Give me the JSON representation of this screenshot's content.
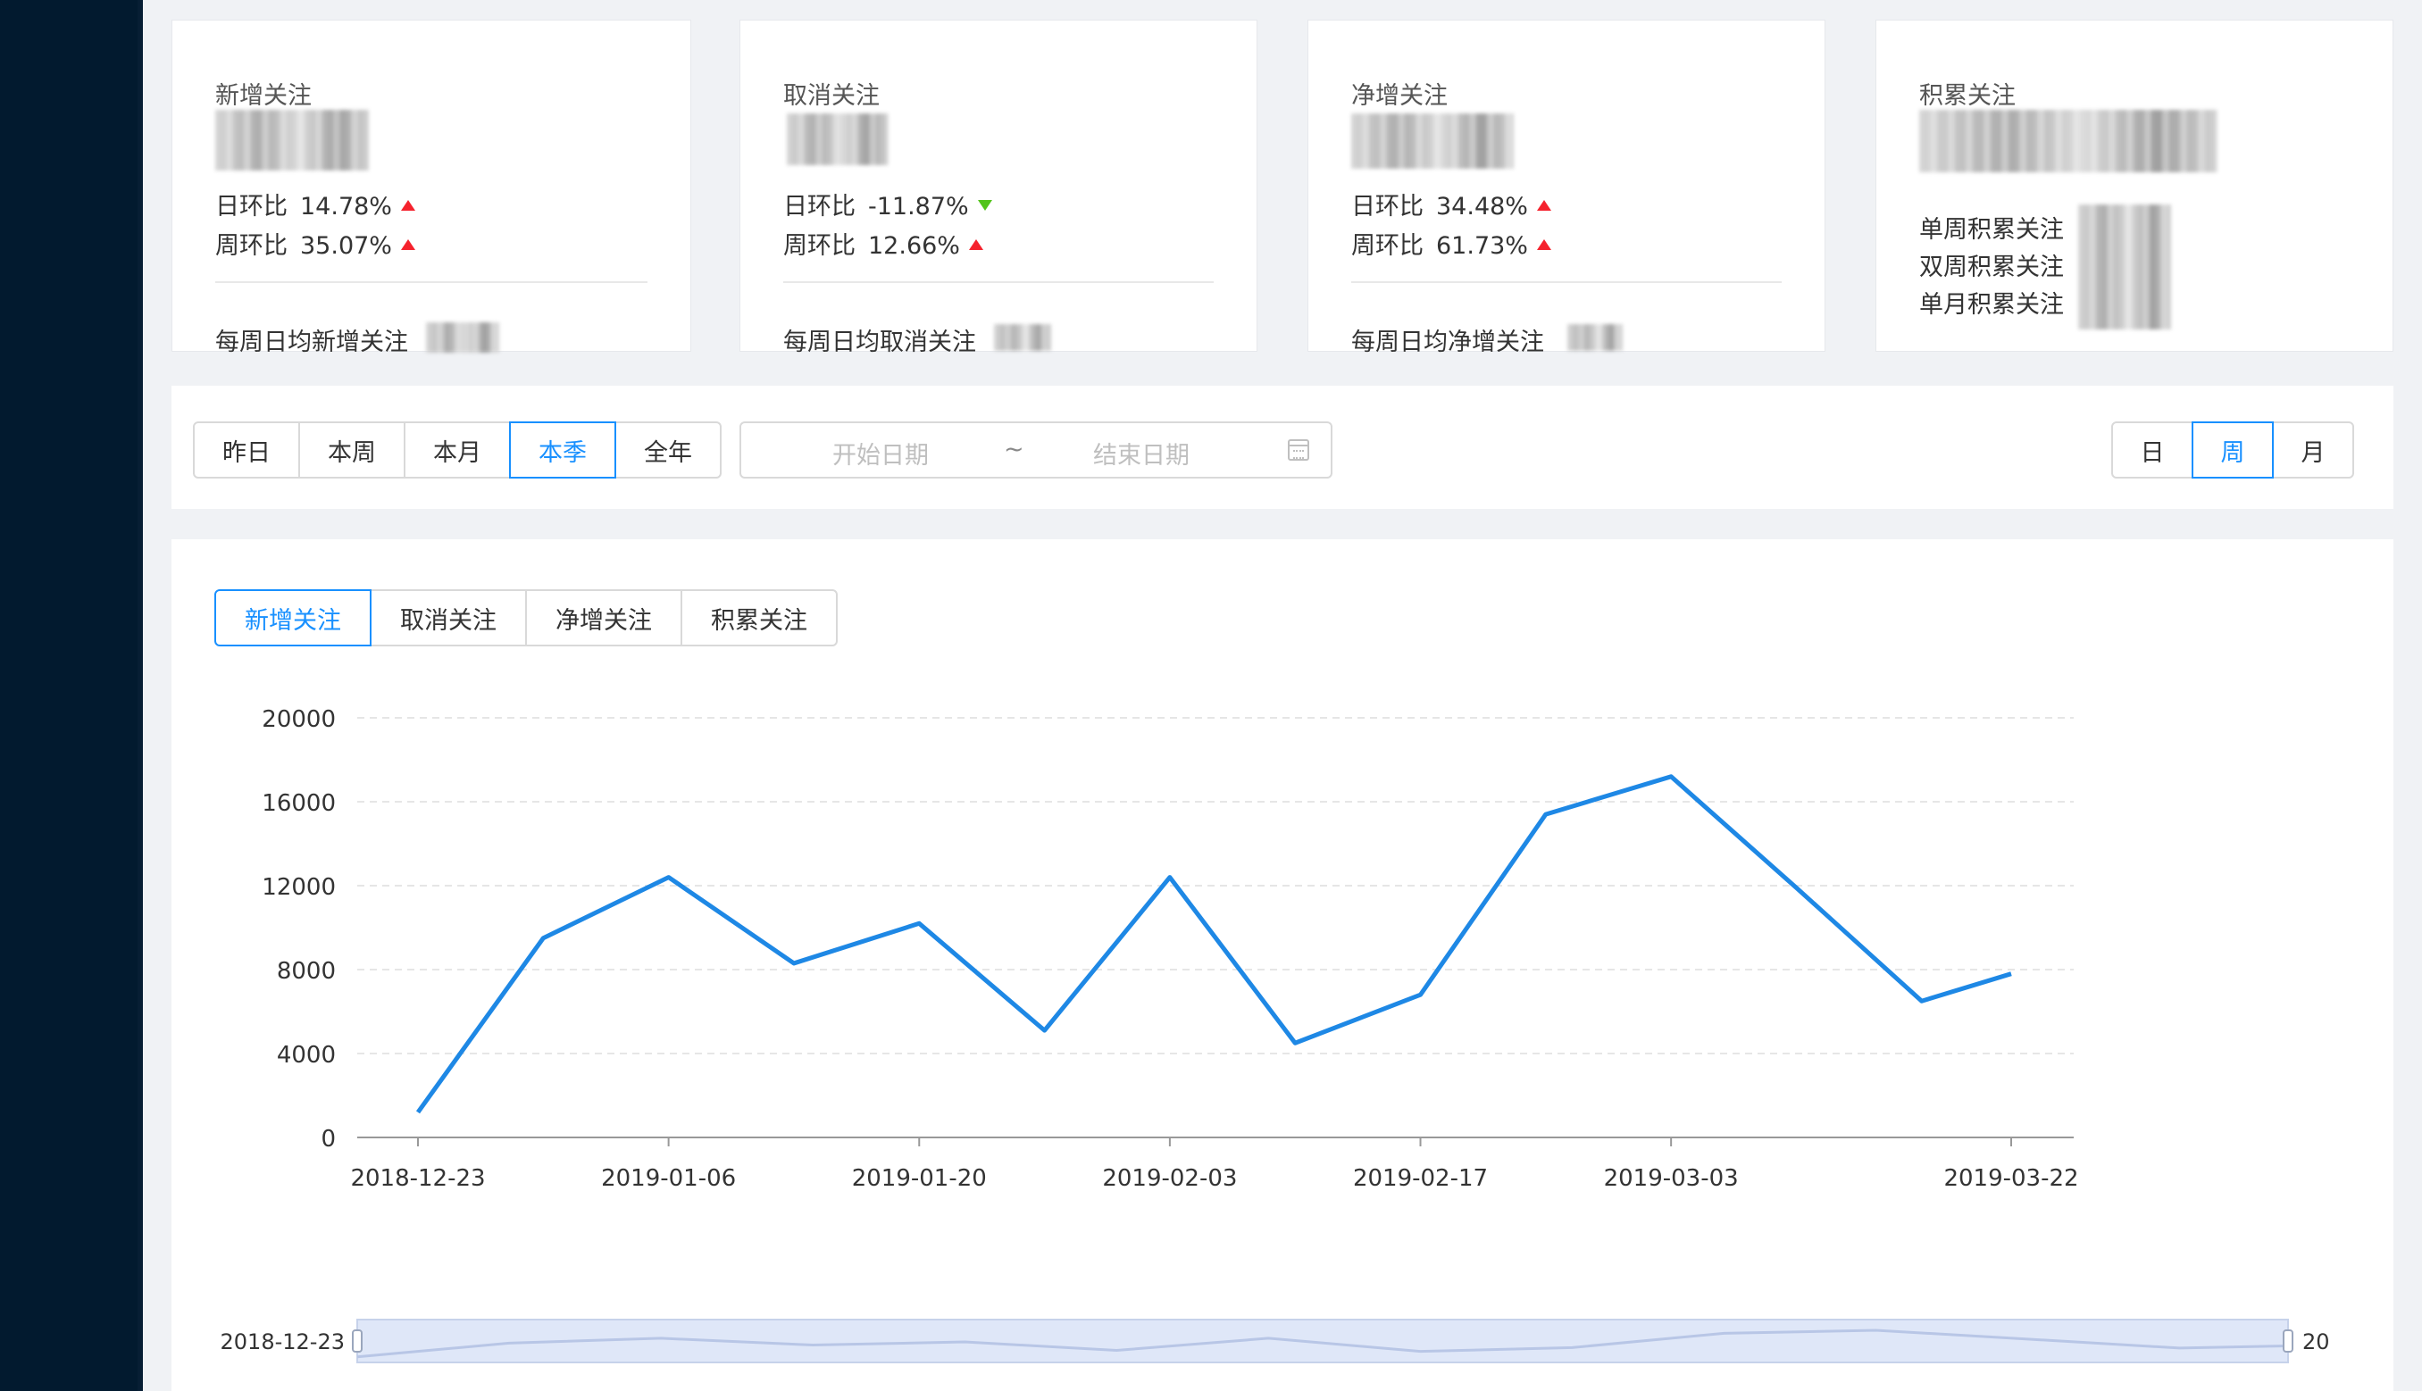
{
  "colors": {
    "accent": "#1890ff",
    "up": "#f5222d",
    "down": "#52c41a",
    "sidebar": "#021a2f",
    "line": "#1e88e5"
  },
  "cards": [
    {
      "title": "新增关注",
      "day_label": "日环比",
      "day_value": "14.78%",
      "day_trend": "up",
      "week_label": "周环比",
      "week_value": "35.07%",
      "week_trend": "up",
      "avg_label": "每周日均新增关注"
    },
    {
      "title": "取消关注",
      "day_label": "日环比",
      "day_value": "-11.87%",
      "day_trend": "down",
      "week_label": "周环比",
      "week_value": "12.66%",
      "week_trend": "up",
      "avg_label": "每周日均取消关注"
    },
    {
      "title": "净增关注",
      "day_label": "日环比",
      "day_value": "34.48%",
      "day_trend": "up",
      "week_label": "周环比",
      "week_value": "61.73%",
      "week_trend": "up",
      "avg_label": "每周日均净增关注"
    }
  ],
  "accumulate": {
    "title": "积累关注",
    "items": [
      "单周积累关注",
      "双周积累关注",
      "单月积累关注"
    ]
  },
  "period_buttons": [
    "昨日",
    "本周",
    "本月",
    "本季",
    "全年"
  ],
  "period_active": "本季",
  "date_range": {
    "start_placeholder": "开始日期",
    "separator": "~",
    "end_placeholder": "结束日期",
    "icon": "calendar-icon"
  },
  "granularity_buttons": [
    "日",
    "周",
    "月"
  ],
  "granularity_active": "周",
  "chart_tabs": [
    "新增关注",
    "取消关注",
    "净增关注",
    "积累关注"
  ],
  "chart_tab_active": "新增关注",
  "chart_data": {
    "type": "line",
    "x": [
      "2018-12-23",
      "2018-12-30",
      "2019-01-06",
      "2019-01-13",
      "2019-01-20",
      "2019-01-27",
      "2019-02-03",
      "2019-02-10",
      "2019-02-17",
      "2019-02-24",
      "2019-03-03",
      "2019-03-10",
      "2019-03-17",
      "2019-03-22"
    ],
    "series": [
      {
        "values": [
          1200,
          9500,
          12400,
          8300,
          10200,
          5100,
          12400,
          4500,
          6800,
          15400,
          17200,
          11900,
          6500,
          7800
        ]
      }
    ],
    "x_tick_labels": [
      "2018-12-23",
      "2019-01-06",
      "2019-01-20",
      "2019-02-03",
      "2019-02-17",
      "2019-03-03",
      "2019-03-22"
    ],
    "y_ticks": [
      0,
      4000,
      8000,
      12000,
      16000,
      20000
    ],
    "ylim": [
      0,
      20000
    ],
    "grid": true,
    "zoom_start_label": "2018-12-23",
    "zoom_end_label": "20"
  }
}
